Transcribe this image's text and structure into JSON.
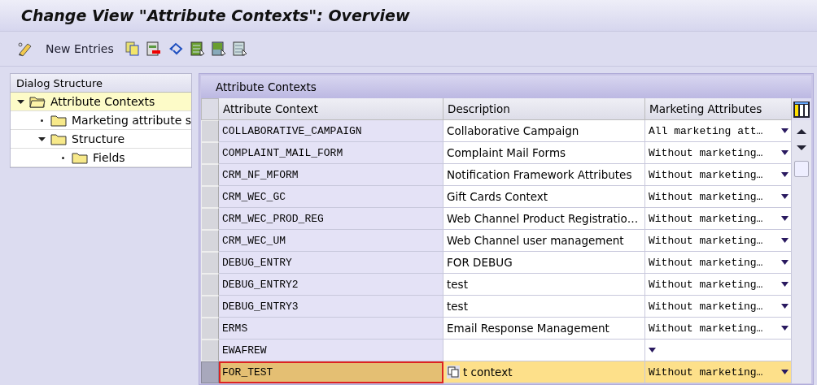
{
  "window": {
    "title": "Change View \"Attribute Contexts\": Overview"
  },
  "toolbar": {
    "new_entries": "New Entries"
  },
  "dialog_structure": {
    "title": "Dialog Structure",
    "tree": [
      {
        "label": "Attribute Contexts",
        "expanded": true,
        "selected": true,
        "children": [
          {
            "label": "Marketing attribute s",
            "expanded": false,
            "selected": false
          },
          {
            "label": "Structure",
            "expanded": true,
            "selected": false,
            "children": [
              {
                "label": "Fields",
                "expanded": false,
                "selected": false
              }
            ]
          }
        ]
      }
    ]
  },
  "table": {
    "title": "Attribute Contexts",
    "columns": [
      "Attribute Context",
      "Description",
      "Marketing Attributes"
    ],
    "rows": [
      {
        "context": "COLLABORATIVE_CAMPAIGN",
        "description": "Collaborative Campaign",
        "marketing": "All marketing att…",
        "selected": false
      },
      {
        "context": "COMPLAINT_MAIL_FORM",
        "description": "Complaint Mail Forms",
        "marketing": "Without marketing…",
        "selected": false
      },
      {
        "context": "CRM_NF_MFORM",
        "description": "Notification Framework Attributes",
        "marketing": "Without marketing…",
        "selected": false
      },
      {
        "context": "CRM_WEC_GC",
        "description": "Gift Cards Context",
        "marketing": "Without marketing…",
        "selected": false
      },
      {
        "context": "CRM_WEC_PROD_REG",
        "description": "Web Channel Product Registratio…",
        "marketing": "Without marketing…",
        "selected": false
      },
      {
        "context": "CRM_WEC_UM",
        "description": "Web Channel user management",
        "marketing": "Without marketing…",
        "selected": false
      },
      {
        "context": "DEBUG_ENTRY",
        "description": "FOR DEBUG",
        "marketing": "Without marketing…",
        "selected": false
      },
      {
        "context": "DEBUG_ENTRY2",
        "description": "test",
        "marketing": "Without marketing…",
        "selected": false
      },
      {
        "context": "DEBUG_ENTRY3",
        "description": "test",
        "marketing": "Without marketing…",
        "selected": false
      },
      {
        "context": "ERMS",
        "description": "Email Response Management",
        "marketing": "Without marketing…",
        "selected": false
      },
      {
        "context": "EWAFREW",
        "selected": false
      },
      {
        "context": "FOR_TEST",
        "description": "t context",
        "marketing": "Without marketing…",
        "selected": true
      }
    ]
  }
}
